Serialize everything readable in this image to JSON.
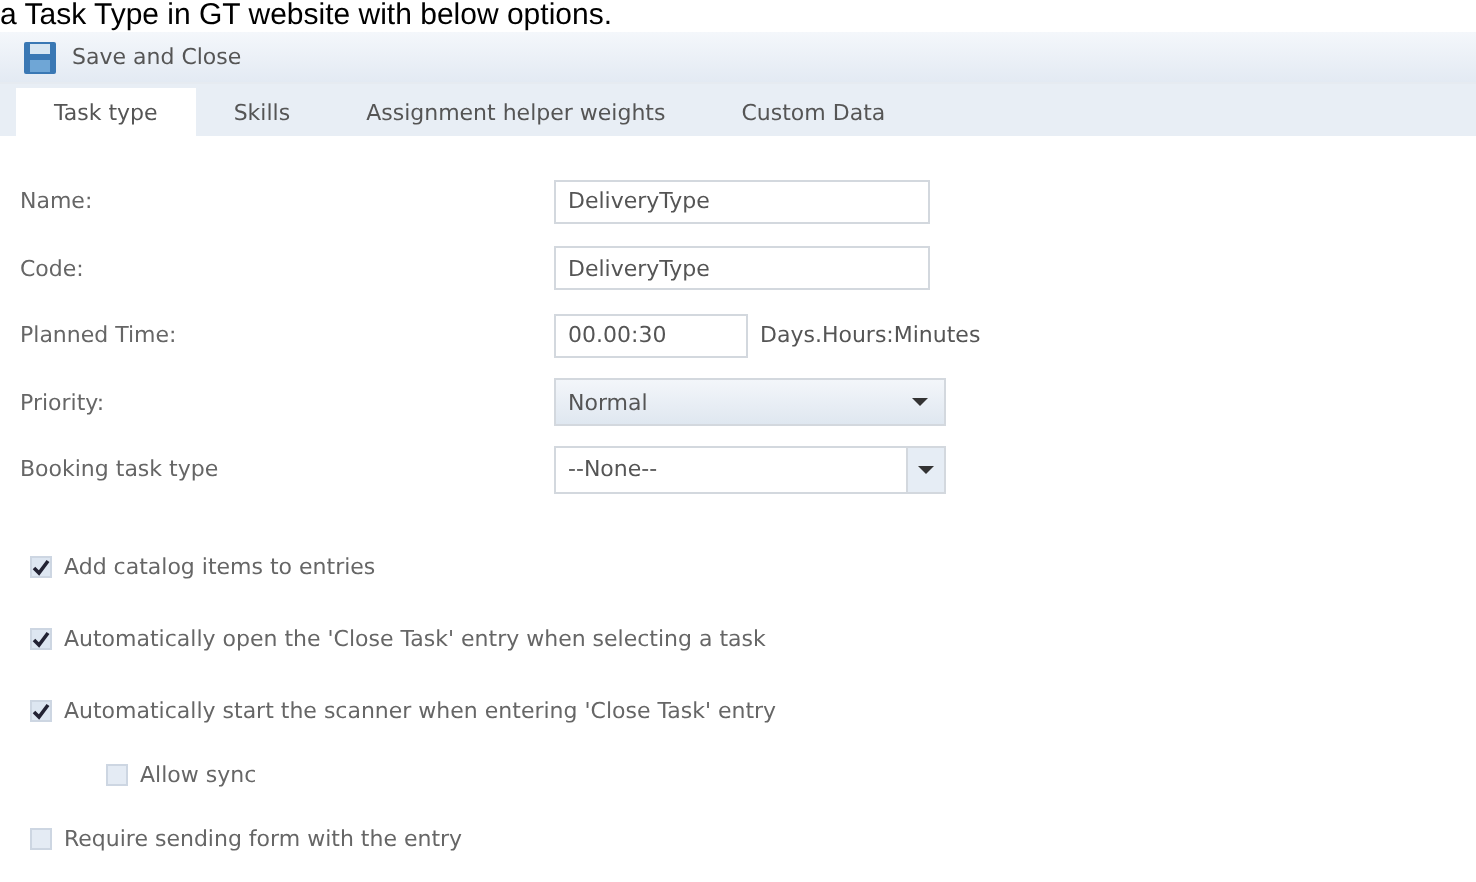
{
  "caption": "a Task Type in GT website with below options.",
  "toolbar": {
    "button": "Save and Close"
  },
  "tabs": [
    {
      "label": "Task type",
      "selected": true
    },
    {
      "label": "Skills",
      "selected": false
    },
    {
      "label": "Assignment helper weights",
      "selected": false
    },
    {
      "label": "Custom Data",
      "selected": false
    }
  ],
  "fields": [
    {
      "label": "Name:",
      "kind": "text",
      "value": "DeliveryType"
    },
    {
      "label": "Code:",
      "kind": "text",
      "value": "DeliveryType"
    },
    {
      "label": "Planned Time:",
      "kind": "time",
      "value": "00.00:30",
      "unit": "Days.Hours:Minutes"
    },
    {
      "label": "Priority:",
      "kind": "select",
      "value": "Normal"
    },
    {
      "label": "Booking task type",
      "kind": "combo",
      "value": "--None--"
    }
  ],
  "options": [
    {
      "label": "Add catalog items to entries",
      "checked": true
    },
    {
      "label": "Automatically open the 'Close Task' entry when selecting a task",
      "checked": true
    },
    {
      "label": "Automatically start the scanner when entering 'Close Task' entry",
      "checked": true,
      "children": [
        {
          "label": "Allow sync",
          "checked": false
        }
      ]
    },
    {
      "label": "Require sending form with the entry",
      "checked": false
    }
  ]
}
